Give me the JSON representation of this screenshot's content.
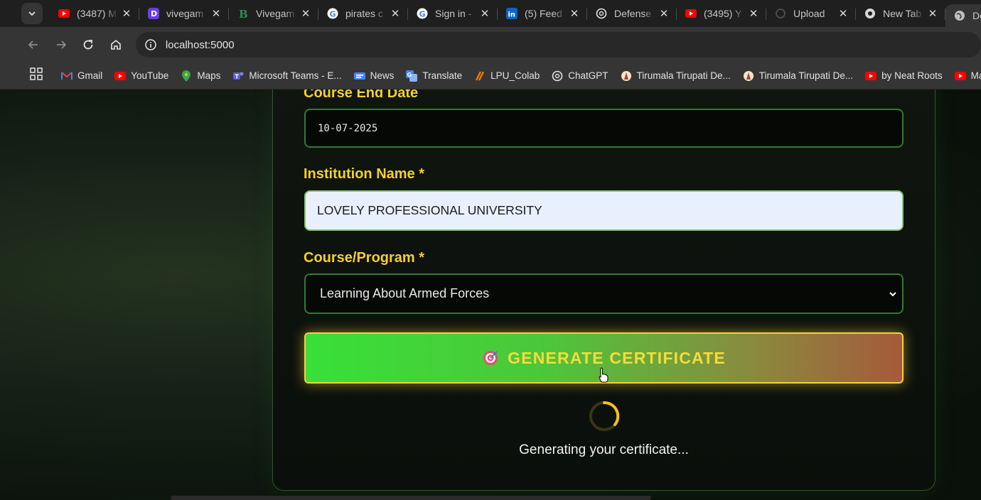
{
  "browser": {
    "tabs": [
      {
        "title": "(3487) M",
        "icon": "youtube-icon"
      },
      {
        "title": "vivegam",
        "icon": "dailymotion-icon"
      },
      {
        "title": "Vivegam",
        "icon": "b-icon"
      },
      {
        "title": "pirates c",
        "icon": "google-icon"
      },
      {
        "title": "Sign in -",
        "icon": "google-icon"
      },
      {
        "title": "(5) Feed",
        "icon": "linkedin-icon"
      },
      {
        "title": "Defense",
        "icon": "openai-icon"
      },
      {
        "title": "(3495) Y",
        "icon": "youtube-icon"
      },
      {
        "title": "Upload",
        "icon": "loading-icon"
      },
      {
        "title": "New Tab",
        "icon": "chrome-icon"
      },
      {
        "title": "De",
        "icon": "globe-icon"
      }
    ],
    "url": "localhost:5000",
    "bookmarks": [
      {
        "label": "Gmail"
      },
      {
        "label": "YouTube"
      },
      {
        "label": "Maps"
      },
      {
        "label": "Microsoft Teams - E..."
      },
      {
        "label": "News"
      },
      {
        "label": "Translate"
      },
      {
        "label": "LPU_Colab"
      },
      {
        "label": "ChatGPT"
      },
      {
        "label": "Tirumala Tirupati De..."
      },
      {
        "label": "Tirumala Tirupati De..."
      },
      {
        "label": "by Neat Roots"
      },
      {
        "label": "Machi"
      }
    ]
  },
  "form": {
    "end_date_label": "Course End Date",
    "end_date_value": "10-07-2025",
    "institution_label": "Institution Name *",
    "institution_value": "LOVELY PROFESSIONAL UNIVERSITY",
    "course_label": "Course/Program *",
    "course_value": "Learning About Armed Forces",
    "generate_label": "GENERATE CERTIFICATE",
    "status_text": "Generating your certificate..."
  },
  "colors": {
    "accent_yellow": "#f4d12a",
    "field_border": "#2e7d2e",
    "button_start": "#38e038",
    "button_end": "#a65a3a"
  }
}
